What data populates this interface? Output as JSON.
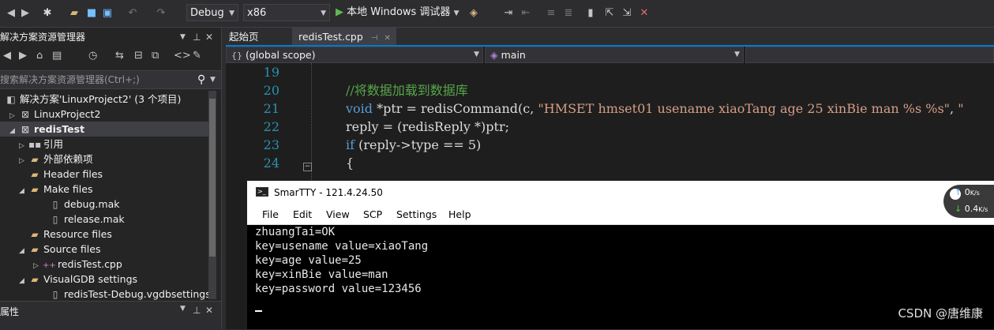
{
  "toolbar": {
    "config": "Debug",
    "platform": "x86",
    "run_label": "本地 Windows 调试器",
    "run_dropdown_icon": "chevron-down-icon"
  },
  "solution_explorer": {
    "title": "解决方案资源管理器",
    "search_placeholder": "搜索解决方案资源管理器(Ctrl+;)",
    "items": [
      {
        "label": "解决方案'LinuxProject2' (3 个项目)",
        "icon": "solution-icon"
      },
      {
        "label": "LinuxProject2",
        "icon": "project-icon"
      },
      {
        "label": "redisTest",
        "icon": "project-icon"
      },
      {
        "label": "引用",
        "icon": "references-icon"
      },
      {
        "label": "外部依赖项",
        "icon": "external-deps-icon"
      },
      {
        "label": "Header files",
        "icon": "folder-icon"
      },
      {
        "label": "Make files",
        "icon": "folder-open-icon"
      },
      {
        "label": "debug.mak",
        "icon": "file-icon"
      },
      {
        "label": "release.mak",
        "icon": "file-icon"
      },
      {
        "label": "Resource files",
        "icon": "folder-icon"
      },
      {
        "label": "Source files",
        "icon": "folder-open-icon"
      },
      {
        "label": "redisTest.cpp",
        "icon": "cpp-file-icon"
      },
      {
        "label": "VisualGDB settings",
        "icon": "folder-open-icon"
      },
      {
        "label": "redisTest-Debug.vgdbsettings",
        "icon": "file-icon"
      }
    ],
    "properties_title": "属性"
  },
  "editor": {
    "tabs": [
      {
        "label": "起始页"
      },
      {
        "label": "redisTest.cpp"
      }
    ],
    "scope": "(global scope)",
    "member": "main",
    "lines": [
      {
        "num": "19",
        "code": ""
      },
      {
        "num": "20",
        "code": "//将数据加载到数据库"
      },
      {
        "num": "21",
        "code": "void *ptr = redisCommand(c, \"HMSET hmset01 usename xiaoTang age 25 xinBie man %s %s\", \""
      },
      {
        "num": "22",
        "code": "reply = (redisReply *)ptr;"
      },
      {
        "num": "23",
        "code": "if (reply->type == 5)"
      },
      {
        "num": "24",
        "code": "{"
      }
    ]
  },
  "smartty": {
    "title": "SmarTTY - 121.4.24.50",
    "menu": [
      "File",
      "Edit",
      "View",
      "SCP",
      "Settings",
      "Help"
    ],
    "lines": [
      "zhuangTai=OK",
      "key=usename value=xiaoTang",
      "key=age value=25",
      "key=xinBie value=man",
      "key=password value=123456"
    ],
    "net_up": "0",
    "net_up_unit": "K/s",
    "net_down": "0.4",
    "net_down_unit": "K/s"
  },
  "watermark": "CSDN @唐维康"
}
